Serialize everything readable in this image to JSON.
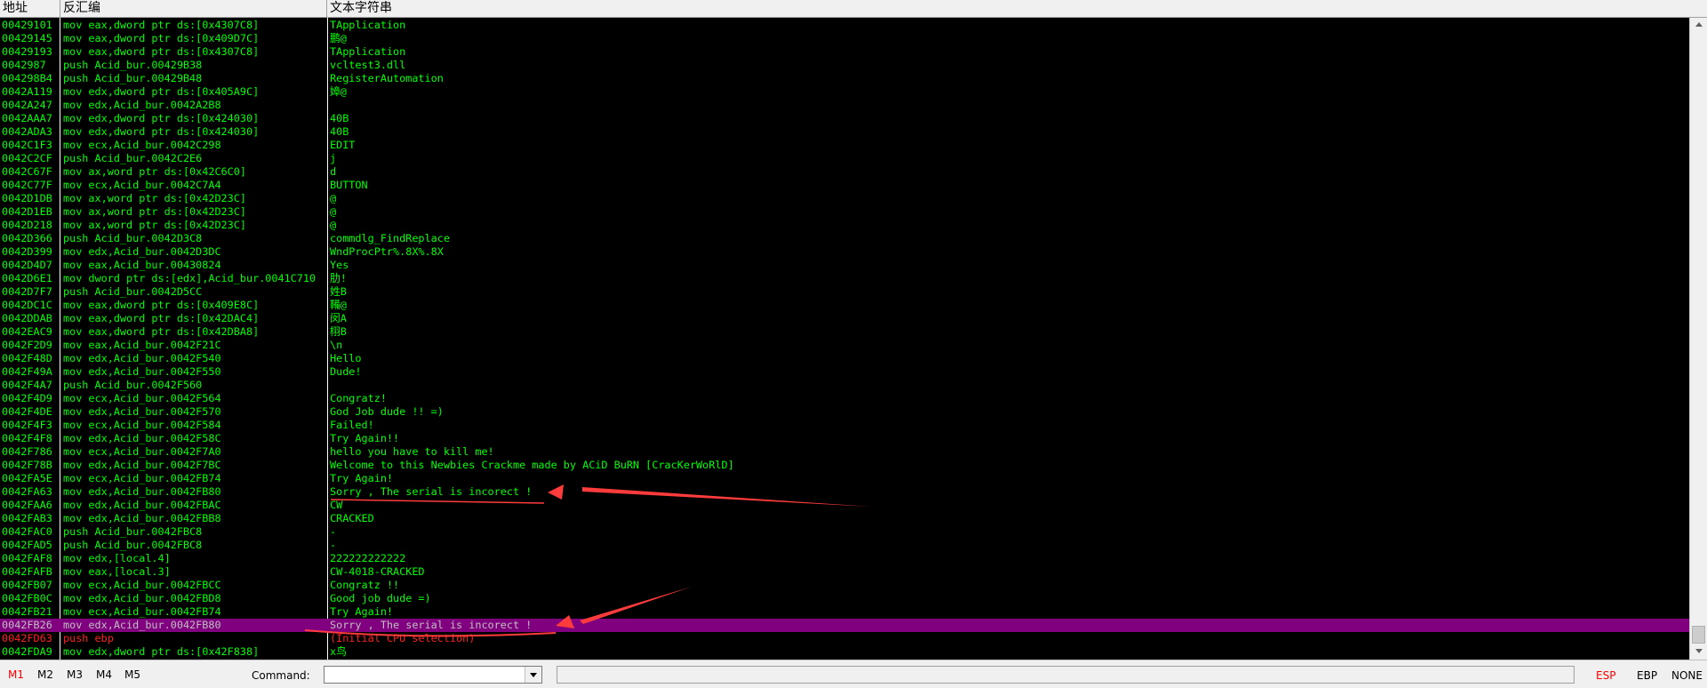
{
  "columns": {
    "address": "地址",
    "disassembly": "反汇编",
    "text_string": "文本字符串"
  },
  "rows": [
    {
      "addr": "00429101",
      "dis": "mov eax,dword ptr ds:[0x4307C8]",
      "str": "TApplication"
    },
    {
      "addr": "00429145",
      "dis": "mov eax,dword ptr ds:[0x409D7C]",
      "str": "鹏@"
    },
    {
      "addr": "00429193",
      "dis": "mov eax,dword ptr ds:[0x4307C8]",
      "str": "TApplication"
    },
    {
      "addr": "0042987",
      "dis": "push Acid_bur.00429B38",
      "str": "vcltest3.dll"
    },
    {
      "addr": "004298B4",
      "dis": "push Acid_bur.00429B48",
      "str": "RegisterAutomation"
    },
    {
      "addr": "0042A119",
      "dis": "mov edx,dword ptr ds:[0x405A9C]",
      "str": "嫜@"
    },
    {
      "addr": "0042A247",
      "dis": "mov edx,Acid_bur.0042A2B8",
      "str": ""
    },
    {
      "addr": "0042AAA7",
      "dis": "mov edx,dword ptr ds:[0x424030]",
      "str": "40B"
    },
    {
      "addr": "0042ADA3",
      "dis": "mov edx,dword ptr ds:[0x424030]",
      "str": "40B"
    },
    {
      "addr": "0042C1F3",
      "dis": "mov ecx,Acid_bur.0042C298",
      "str": "EDIT"
    },
    {
      "addr": "0042C2CF",
      "dis": "push Acid_bur.0042C2E6",
      "str": "j"
    },
    {
      "addr": "0042C67F",
      "dis": "mov ax,word ptr ds:[0x42C6C0]",
      "str": "d"
    },
    {
      "addr": "0042C77F",
      "dis": "mov ecx,Acid_bur.0042C7A4",
      "str": "BUTTON"
    },
    {
      "addr": "0042D1DB",
      "dis": "mov ax,word ptr ds:[0x42D23C]",
      "str": "@"
    },
    {
      "addr": "0042D1EB",
      "dis": "mov ax,word ptr ds:[0x42D23C]",
      "str": "@"
    },
    {
      "addr": "0042D218",
      "dis": "mov ax,word ptr ds:[0x42D23C]",
      "str": "@"
    },
    {
      "addr": "0042D366",
      "dis": "push Acid_bur.0042D3C8",
      "str": "commdlg_FindReplace"
    },
    {
      "addr": "0042D399",
      "dis": "mov edx,Acid_bur.0042D3DC",
      "str": "WndProcPtr%.8X%.8X"
    },
    {
      "addr": "0042D4D7",
      "dis": "mov eax,Acid_bur.00430824",
      "str": "Yes"
    },
    {
      "addr": "0042D6E1",
      "dis": "mov dword ptr ds:[edx],Acid_bur.0041C710",
      "str": "肋!"
    },
    {
      "addr": "0042D7F7",
      "dis": "push Acid_bur.0042D5CC",
      "str": "姓B"
    },
    {
      "addr": "0042DC1C",
      "dis": "mov eax,dword ptr ds:[0x409E8C]",
      "str": "鞴@"
    },
    {
      "addr": "0042DDAB",
      "dis": "mov eax,dword ptr ds:[0x42DAC4]",
      "str": "闵A"
    },
    {
      "addr": "0042EAC9",
      "dis": "mov eax,dword ptr ds:[0x42DBA8]",
      "str": "栩B"
    },
    {
      "addr": "0042F2D9",
      "dis": "mov eax,Acid_bur.0042F21C",
      "str": "\\n"
    },
    {
      "addr": "0042F48D",
      "dis": "mov edx,Acid_bur.0042F540",
      "str": "Hello"
    },
    {
      "addr": "0042F49A",
      "dis": "mov edx,Acid_bur.0042F550",
      "str": "Dude!"
    },
    {
      "addr": "0042F4A7",
      "dis": "push Acid_bur.0042F560",
      "str": ""
    },
    {
      "addr": "0042F4D9",
      "dis": "mov ecx,Acid_bur.0042F564",
      "str": "Congratz!"
    },
    {
      "addr": "0042F4DE",
      "dis": "mov edx,Acid_bur.0042F570",
      "str": "God Job dude !! =)"
    },
    {
      "addr": "0042F4F3",
      "dis": "mov ecx,Acid_bur.0042F584",
      "str": "Failed!"
    },
    {
      "addr": "0042F4F8",
      "dis": "mov edx,Acid_bur.0042F58C",
      "str": "Try Again!!"
    },
    {
      "addr": "0042F786",
      "dis": "mov ecx,Acid_bur.0042F7A0",
      "str": "hello you have to kill me!"
    },
    {
      "addr": "0042F78B",
      "dis": "mov edx,Acid_bur.0042F7BC",
      "str": "Welcome to this Newbies Crackme made by ACiD BuRN [CracKerWoRlD]"
    },
    {
      "addr": "0042FA5E",
      "dis": "mov ecx,Acid_bur.0042FB74",
      "str": "Try Again!"
    },
    {
      "addr": "0042FA63",
      "dis": "mov edx,Acid_bur.0042FB80",
      "str": "Sorry , The serial is incorect !"
    },
    {
      "addr": "0042FAA6",
      "dis": "mov edx,Acid_bur.0042FBAC",
      "str": "CW"
    },
    {
      "addr": "0042FAB3",
      "dis": "mov edx,Acid_bur.0042FBB8",
      "str": "CRACKED"
    },
    {
      "addr": "0042FAC0",
      "dis": "push Acid_bur.0042FBC8",
      "str": "-"
    },
    {
      "addr": "0042FAD5",
      "dis": "push Acid_bur.0042FBC8",
      "str": "-"
    },
    {
      "addr": "0042FAF8",
      "dis": "mov edx,[local.4]",
      "str": "222222222222"
    },
    {
      "addr": "0042FAFB",
      "dis": "mov eax,[local.3]",
      "str": "CW-4018-CRACKED"
    },
    {
      "addr": "0042FB07",
      "dis": "mov ecx,Acid_bur.0042FBCC",
      "str": "Congratz !!"
    },
    {
      "addr": "0042FB0C",
      "dis": "mov edx,Acid_bur.0042FBD8",
      "str": "Good job dude =)"
    },
    {
      "addr": "0042FB21",
      "dis": "mov ecx,Acid_bur.0042FB74",
      "str": "Try Again!"
    },
    {
      "addr": "0042FB26",
      "dis": "mov edx,Acid_bur.0042FB80",
      "str": "Sorry , The serial is incorect !"
    },
    {
      "addr": "0042FD63",
      "dis": "push ebp",
      "str": "(Initial CPU selection)"
    },
    {
      "addr": "0042FDA9",
      "dis": "mov edx,dword ptr ds:[0x42F838]",
      "str": "x鸟"
    }
  ],
  "bottom_bar": {
    "marks": [
      "M1",
      "M2",
      "M3",
      "M4",
      "M5"
    ],
    "command_label": "Command:",
    "command_value": "",
    "registers": [
      "ESP",
      "EBP",
      "NONE"
    ]
  },
  "colors": {
    "text": "#00ff00",
    "highlight_row": "#800080",
    "annotation": "#ff3b3b",
    "active_mark": "#ff0000"
  }
}
